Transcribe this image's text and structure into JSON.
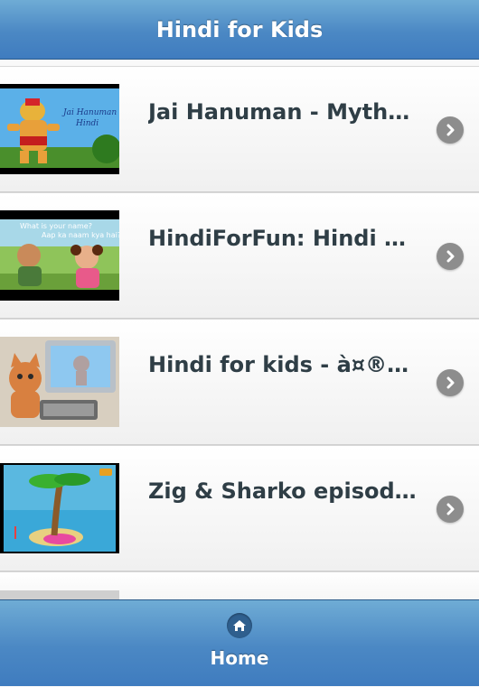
{
  "header": {
    "title": "Hindi for Kids"
  },
  "items": [
    {
      "title": "Jai Hanuman - Mytho...",
      "thumb": "hanuman-cartoon"
    },
    {
      "title": "HindiForFun: Hindi D...",
      "thumb": "kids-conversation-cartoon",
      "thumb_text": "What is your name?",
      "thumb_text2": "Aap ka naam kya hai?"
    },
    {
      "title": "Hindi for kids - à¤®à...",
      "thumb": "cat-computer-cartoon"
    },
    {
      "title": "Zig & Sharko episode...",
      "thumb": "palm-island-cartoon"
    }
  ],
  "footer": {
    "home_label": "Home",
    "home_icon": "home-icon"
  },
  "colors": {
    "bar": "#4b88c4",
    "title_text": "#2f3e46",
    "chevron": "#8d8d8d"
  }
}
